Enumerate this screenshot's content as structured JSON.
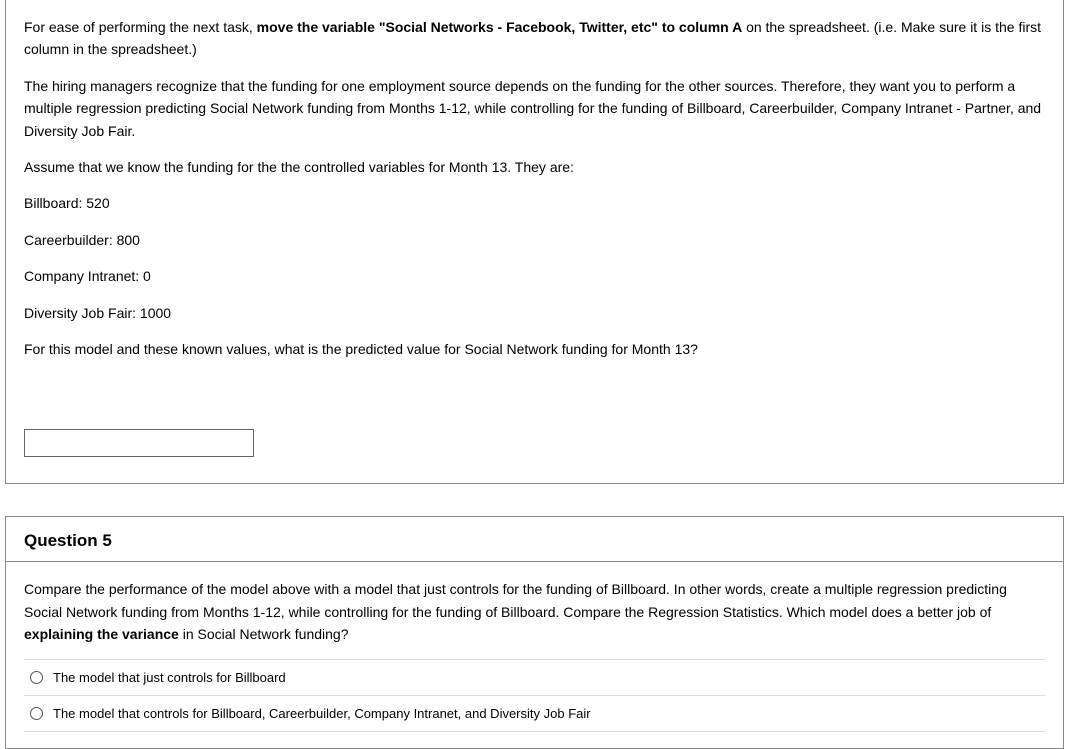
{
  "q4": {
    "p1_a": "For ease of performing the next task, ",
    "p1_b": "move the variable \"Social Networks - Facebook, Twitter, etc\" to column A",
    "p1_c": " on the spreadsheet. (i.e. Make sure it is the first column in the spreadsheet.)",
    "p2": "The hiring managers recognize that the funding for one employment source depends on the funding for the other sources. Therefore, they want you to perform a multiple regression predicting Social Network funding from Months 1-12, while controlling for the funding of Billboard, Careerbuilder, Company Intranet - Partner, and Diversity Job Fair.",
    "p3": "Assume that we know the funding for the the controlled variables for Month 13. They are:",
    "v1": "Billboard: 520",
    "v2": "Careerbuilder: 800",
    "v3": "Company Intranet: 0",
    "v4": "Diversity Job Fair: 1000",
    "p4": "For this model and these known values, what is the predicted value for Social Network funding for Month 13?"
  },
  "q5": {
    "title": "Question 5",
    "p1_a": "Compare the performance of the model above with a model that just controls for the funding of Billboard. In other words, create a multiple regression predicting Social Network funding from Months 1-12, while controlling for the funding of Billboard. Compare the Regression Statistics. Which model does a better job of ",
    "p1_b": "explaining the variance",
    "p1_c": " in Social Network funding?",
    "opt1": "The model that just controls for Billboard",
    "opt2": "The model that controls for Billboard, Careerbuilder, Company Intranet, and Diversity Job Fair"
  }
}
